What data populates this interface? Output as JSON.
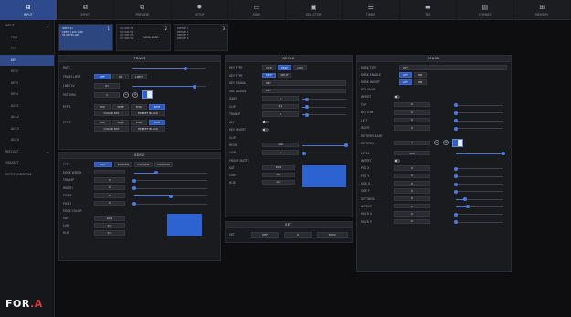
{
  "topbar": [
    {
      "label": "INPUT",
      "icon": "⧉",
      "active": true
    },
    {
      "label": "INPUT",
      "icon": "⧉",
      "active": false
    },
    {
      "label": "PREVIEW",
      "icon": "⧉",
      "active": false
    },
    {
      "label": "SETUP",
      "icon": "✹",
      "active": false
    },
    {
      "label": "EDID",
      "icon": "▭",
      "active": false
    },
    {
      "label": "SELECTOR",
      "icon": "▣",
      "active": false
    },
    {
      "label": "TIMER",
      "icon": "☰",
      "active": false
    },
    {
      "label": "TBS",
      "icon": "▬",
      "active": false
    },
    {
      "label": "FORMAT",
      "icon": "▤",
      "active": false
    },
    {
      "label": "MEMORY",
      "icon": "⊞",
      "active": false
    }
  ],
  "sidebar": {
    "items": [
      "INPUT",
      "PGM",
      "PST",
      "KEY",
      "KEY2",
      "KEY3",
      "KEY4",
      "AUX1",
      "AUX2",
      "AUX3",
      "AUX4",
      "REFLOAT",
      "GRASSET",
      "REFEST/CAMERA2"
    ],
    "active_index": 3
  },
  "logo": {
    "main": "FOR",
    "accent": ".A"
  },
  "strip": [
    {
      "num": "1",
      "lines": [
        "INPUT 01",
        "VIDEO 1920 1080",
        "59.94 FPS ABC"
      ],
      "big": "",
      "selected": true
    },
    {
      "num": "2",
      "lines": [
        "SDI INPUT 1",
        "SDI INPUT 2",
        "SDI INPUT 3",
        "SDI INPUT 4"
      ],
      "big": "LUMA DISC",
      "selected": false
    },
    {
      "num": "3",
      "lines": [
        "PRESET 1",
        "PRESET 2",
        "PRESET 3",
        "PRESET 4"
      ],
      "big": "",
      "selected": false
    }
  ],
  "trans": {
    "title": "TRANS",
    "rows": [
      {
        "label": "RATE",
        "value": "",
        "slider": 0.72
      },
      {
        "label": "TRANS LIMIT",
        "opts": [
          "OFF",
          "ON",
          "LIMIT"
        ],
        "sel": 0
      },
      {
        "label": "LIMIT LV",
        "value": "01",
        "slider": 0.85
      },
      {
        "label": "PATTERN",
        "value": "1"
      },
      {
        "label": "EFF 1",
        "opts": [
          "MIX",
          "WIPE",
          "DSK",
          "DVE"
        ],
        "sel": 3,
        "opts2": [
          "COLOR MIX",
          "PRESET BLACK"
        ]
      },
      {
        "label": "EFF 2",
        "opts": [
          "MIX",
          "WIPE",
          "DSK",
          "DVE"
        ],
        "sel": 3,
        "opts2": [
          "COLOR MIX",
          "PRESET BLACK"
        ]
      }
    ]
  },
  "edge": {
    "title": "EDGE",
    "type_opts": [
      "OFF",
      "BORDER",
      "OUTLINE",
      "SHADOW"
    ],
    "type_sel": 0,
    "rows": [
      {
        "label": "TYPE"
      },
      {
        "label": "EDGE WIDTH",
        "value": "",
        "slider": 0.3
      },
      {
        "label": "TRANSP",
        "value": "0",
        "slider": 0.0
      },
      {
        "label": "WIDTH",
        "value": "0",
        "slider": 0.0
      },
      {
        "label": "POS X",
        "value": "0",
        "slider": 0.5
      },
      {
        "label": "POS Y",
        "value": "0",
        "slider": 0.0
      }
    ],
    "color_title": "EDGE COLOR",
    "color_rows": [
      {
        "label": "SAT",
        "value": "90.0"
      },
      {
        "label": "LUM",
        "value": "0.0"
      },
      {
        "label": "HUE",
        "value": "0.0"
      }
    ]
  },
  "keyer": {
    "title": "KEYER",
    "rows": [
      {
        "label": "KEY TYPE",
        "opts": [
          "CHR",
          "SELF",
          "LUM"
        ],
        "sel": 1
      },
      {
        "label": "KEY TYPE",
        "opts": [
          "SELF",
          "SPLIT"
        ],
        "sel": 0
      },
      {
        "label": "KEY SIGNAL",
        "value": "KEY"
      },
      {
        "label": "SRC SIGNAL",
        "value": "KEY"
      },
      {
        "label": "GAIN",
        "value": "0",
        "slider": 0.1
      },
      {
        "label": "CLIP",
        "value": "0.1",
        "slider": 0.1
      },
      {
        "label": "TRANSP",
        "value": "0",
        "slider": 0.1
      },
      {
        "label": "INV",
        "toggle": true
      },
      {
        "label": "KEY INVERT",
        "toggle": true
      }
    ],
    "clip_title": "CLIP",
    "clip_rows": [
      {
        "label": "HIGH",
        "value": "100",
        "slider": 1.0
      },
      {
        "label": "LOW",
        "value": "0",
        "slider": 0.05
      }
    ],
    "matte_title": "FRONT MATTE",
    "matte_rows": [
      {
        "label": "SAT",
        "value": "90.0"
      },
      {
        "label": "LUM",
        "value": "0.0"
      },
      {
        "label": "HUE",
        "value": "0.0"
      }
    ]
  },
  "set": {
    "title": "SET",
    "label": "SET",
    "value": "OFF",
    "mid": "0",
    "action": "EXEC"
  },
  "mask": {
    "title": "MASK",
    "rows": [
      {
        "label": "MASK TYPE",
        "value": "OFF"
      },
      {
        "label": "MASK ENABLE",
        "opts": [
          "OFF",
          "ON"
        ],
        "sel": 0
      },
      {
        "label": "MASK INVERT",
        "opts": [
          "OFF",
          "ON"
        ],
        "sel": 0
      }
    ],
    "box_title": "BOX MASK",
    "box_rows": [
      {
        "label": "INVERT",
        "toggle": true
      },
      {
        "label": "TOP",
        "value": "0",
        "slider": 0.0
      },
      {
        "label": "BOTTOM",
        "value": "0",
        "slider": 0.0
      },
      {
        "label": "LEFT",
        "value": "0",
        "slider": 0.0
      },
      {
        "label": "RIGHT",
        "value": "0",
        "slider": 0.0
      }
    ],
    "pattern_title": "PATTERN MASK",
    "pattern_rows": [
      {
        "label": "PATTERN",
        "value": "1"
      },
      {
        "label": "LEVEL",
        "value": "100",
        "slider": 1.0
      },
      {
        "label": "INVERT",
        "toggle": true
      },
      {
        "label": "POS X",
        "value": "0",
        "slider": 0.0
      },
      {
        "label": "POS Y",
        "value": "0",
        "slider": 0.0
      },
      {
        "label": "SIZE X",
        "value": "0",
        "slider": 0.0
      },
      {
        "label": "SIZE Y",
        "value": "0",
        "slider": 0.0
      },
      {
        "label": "SOFTNESS",
        "value": "0",
        "slider": 0.2
      },
      {
        "label": "ASPECT",
        "value": "0",
        "slider": 0.25
      },
      {
        "label": "MULTI X",
        "value": "0",
        "slider": 0.0
      },
      {
        "label": "MULTI Y",
        "value": "0",
        "slider": 0.0
      }
    ]
  },
  "colors": {
    "accent": "#2f58b9",
    "swatch": "#2d62d1",
    "panel": "#1a1b1f"
  }
}
